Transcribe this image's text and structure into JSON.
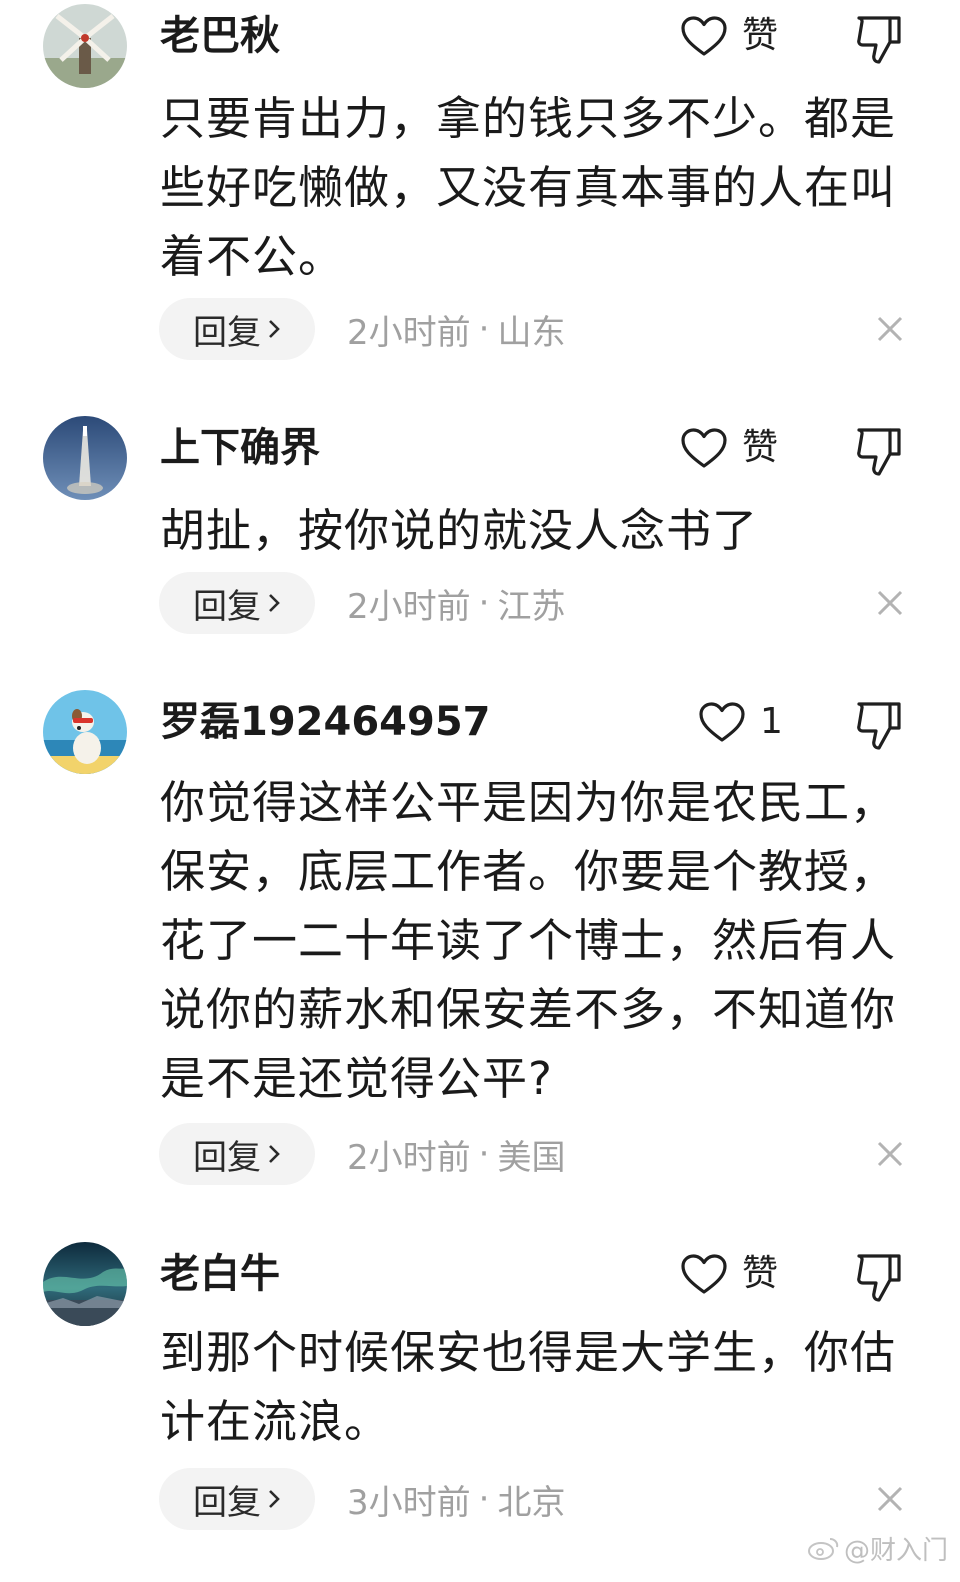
{
  "comments": [
    {
      "username": "老巴秋",
      "like_label": "赞",
      "text": "只要肯出力，拿的钱只多不少。都是些好吃懒做，又没有真本事的人在叫着不公。",
      "reply_label": "回复",
      "time": "2小时前",
      "location": "山东"
    },
    {
      "username": "上下确界",
      "like_label": "赞",
      "text": "胡扯，按你说的就没人念书了",
      "reply_label": "回复",
      "time": "2小时前",
      "location": "江苏"
    },
    {
      "username": "罗磊192464957",
      "like_label": "1",
      "text": "你觉得这样公平是因为你是农民工，保安，底层工作者。你要是个教授，花了一二十年读了个博士，然后有人说你的薪水和保安差不多，不知道你是不是还觉得公平?",
      "reply_label": "回复",
      "time": "2小时前",
      "location": "美国"
    },
    {
      "username": "老白牛",
      "like_label": "赞",
      "text": "到那个时候保安也得是大学生，你估计在流浪。",
      "reply_label": "回复",
      "time": "3小时前",
      "location": "北京"
    }
  ],
  "separator": "·",
  "watermark": "@财入门",
  "icons": {
    "like": "heart-outline-icon",
    "dislike": "thumbs-down-icon",
    "close": "close-icon",
    "chevron": "chevron-right-icon",
    "watermark": "weibo-logo-icon"
  }
}
